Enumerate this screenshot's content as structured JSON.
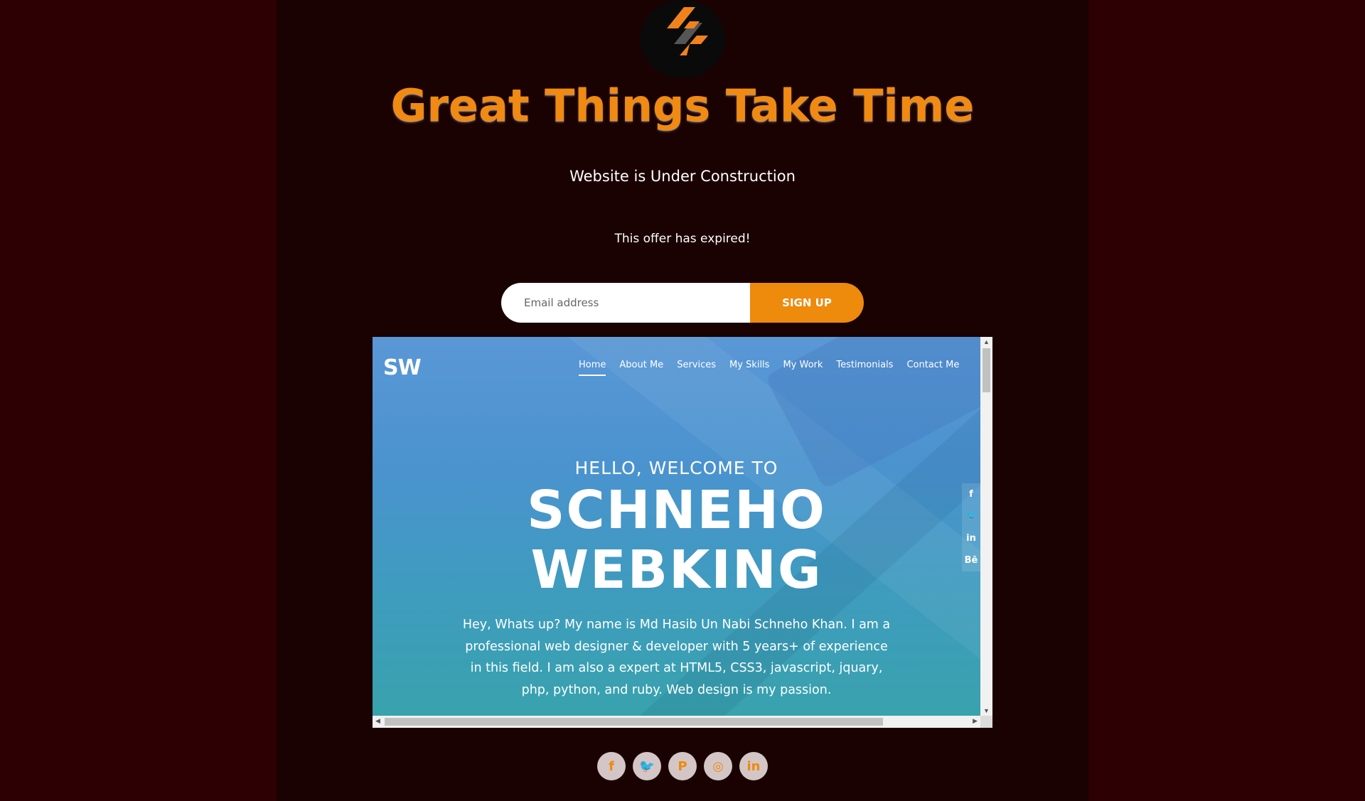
{
  "headline": "Great Things Take Time",
  "subtitle": "Website is Under Construction",
  "offer_text": "This offer has expired!",
  "signup": {
    "placeholder": "Email address",
    "button_label": "SIGN UP"
  },
  "colors": {
    "accent": "#ee8a0c",
    "page_bg": "#2d0003",
    "panel_bg": "#1a0102"
  },
  "preview": {
    "logo": "SW",
    "nav": [
      "Home",
      "About Me",
      "Services",
      "My Skills",
      "My Work",
      "Testimonials",
      "Contact Me"
    ],
    "active_nav": "Home",
    "hero_small": "HELLO, WELCOME TO",
    "hero_line1": "SCHNEHO",
    "hero_line2": "WEBKING",
    "hero_text": "Hey, Whats up? My name is Md Hasib Un Nabi Schneho Khan. I am a professional web designer & developer with 5 years+ of experience in this field. I am also a expert at HTML5, CSS3, javascript, jquary, php, python, and ruby. Web design is my passion.",
    "side_social": [
      {
        "icon": "facebook-icon",
        "glyph": "f"
      },
      {
        "icon": "twitter-icon",
        "glyph": "🐦"
      },
      {
        "icon": "linkedin-icon",
        "glyph": "in"
      },
      {
        "icon": "behance-icon",
        "glyph": "Bē"
      }
    ]
  },
  "social": [
    {
      "icon": "facebook-icon",
      "glyph": "f"
    },
    {
      "icon": "twitter-icon",
      "glyph": "🐦"
    },
    {
      "icon": "pinterest-icon",
      "glyph": "P"
    },
    {
      "icon": "instagram-icon",
      "glyph": "◎"
    },
    {
      "icon": "linkedin-icon",
      "glyph": "in"
    }
  ]
}
